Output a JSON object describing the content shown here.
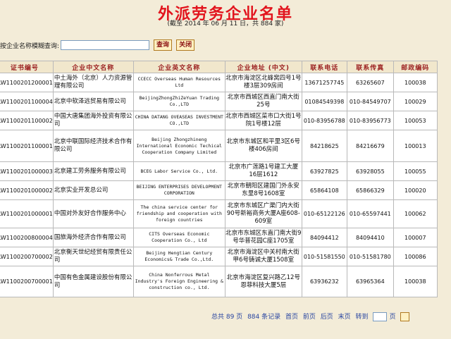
{
  "title": "外派劳务企业名单",
  "subtitle": "(截至 2014 年 06 月 11 日，共 884 家)",
  "search": {
    "label": "按企业名称模糊查询:",
    "value": "",
    "query_button": "查询",
    "close_button": "关闭"
  },
  "table": {
    "headers": [
      "证书编号",
      "企业中文名称",
      "企业英文名称",
      "企业地址 (中文)",
      "联系电话",
      "联系传真",
      "邮政编码"
    ],
    "rows": [
      {
        "id": "LW1100201200001",
        "cn": "中土海外（北京）人力资源管理有限公司",
        "en": "CCECC Overseas Human Resources Ltd",
        "addr": "北京市海淀区北蜂窝四号1号楼3层309房间",
        "tel": "13671257745",
        "fax": "63265607",
        "zip": "100038"
      },
      {
        "id": "LW1100201100004",
        "cn": "北京中软泽远贸易有限公司",
        "en": "BeijingZhongZhiZeYuan Trading Co.,LTD",
        "addr": "北京市西城区西直门南大街25号",
        "tel": "01084549398",
        "fax": "010-84549707",
        "zip": "100029"
      },
      {
        "id": "LW1100201100002",
        "cn": "中国大唐集团海外投资有限公司",
        "en": "CHINA DATANG OVEASEAS INVESTMENT CO.,LTD",
        "addr": "北京市西城区菜市口大街1号院1号楼12层",
        "tel": "010-83956788",
        "fax": "010-83956773",
        "zip": "100053"
      },
      {
        "id": "LW1100201100001",
        "cn": "北京中联国际经济技术合作有限公司",
        "en": "Beijing Zhongzhineng International Economic Techical Cooperation Company Limited",
        "addr": "北京市东城区和平里3区6号楼406房间",
        "tel": "84218625",
        "fax": "84216679",
        "zip": "100013"
      },
      {
        "id": "LW1100201000003",
        "cn": "北京建工劳务服务有限公司",
        "en": "BCEG Labor Service Co., Ltd.",
        "addr": "北京市广莲路1号建工大厦16层1612",
        "tel": "63927825",
        "fax": "63928055",
        "zip": "100055"
      },
      {
        "id": "LW1100201000002",
        "cn": "北京实业开发总公司",
        "en": "BEIJING ENTERPRISES DEVELOPMENT CORPORATION",
        "addr": "北京市朝阳区建国门外永安东里8号1608室",
        "tel": "65864108",
        "fax": "65866329",
        "zip": "100020"
      },
      {
        "id": "LW1100201000001",
        "cn": "中国对外友好合作服务中心",
        "en": "The china service center for friendship and cooperation with foreign countries",
        "addr": "北京市东城区广渠门内大街90号新裕商务大厦A座608-609室",
        "tel": "010-65122126",
        "fax": "010-65597441",
        "zip": "100062"
      },
      {
        "id": "LW1100200800004",
        "cn": "国旅海外经济合作有限公司",
        "en": "CITS Overseas Economic Cooperation Co., Ltd",
        "addr": "北京市东城区东直门南大街9号华普花园C座1705室",
        "tel": "84094412",
        "fax": "84094410",
        "zip": "100007"
      },
      {
        "id": "LW1100200700002",
        "cn": "北京衡天世纪经贸有限责任公司",
        "en": "Beijing Hengtian Century Economics& Trade Co.,Ltd.",
        "addr": "北京市海淀区中关村南大街甲6号铸诚大厦1508室",
        "tel": "010-51581550",
        "fax": "010-51581780",
        "zip": "100086"
      },
      {
        "id": "LW1100200700001",
        "cn": "中国有色金属建设股份有限公司",
        "en": "China Nonferrous Metal Industry's Foreign Engineering & construction co., Ltd.",
        "addr": "北京市海淀区复兴路乙12号恩菲科技大厦5层",
        "tel": "63936232",
        "fax": "63965364",
        "zip": "100038"
      }
    ]
  },
  "pagination": {
    "total_pages_label": "总共 89 页",
    "total_records_label": "884 条记录",
    "first": "首页",
    "prev": "前页",
    "next": "后页",
    "last": "末页",
    "goto_label": "转到",
    "page_suffix": "页"
  }
}
